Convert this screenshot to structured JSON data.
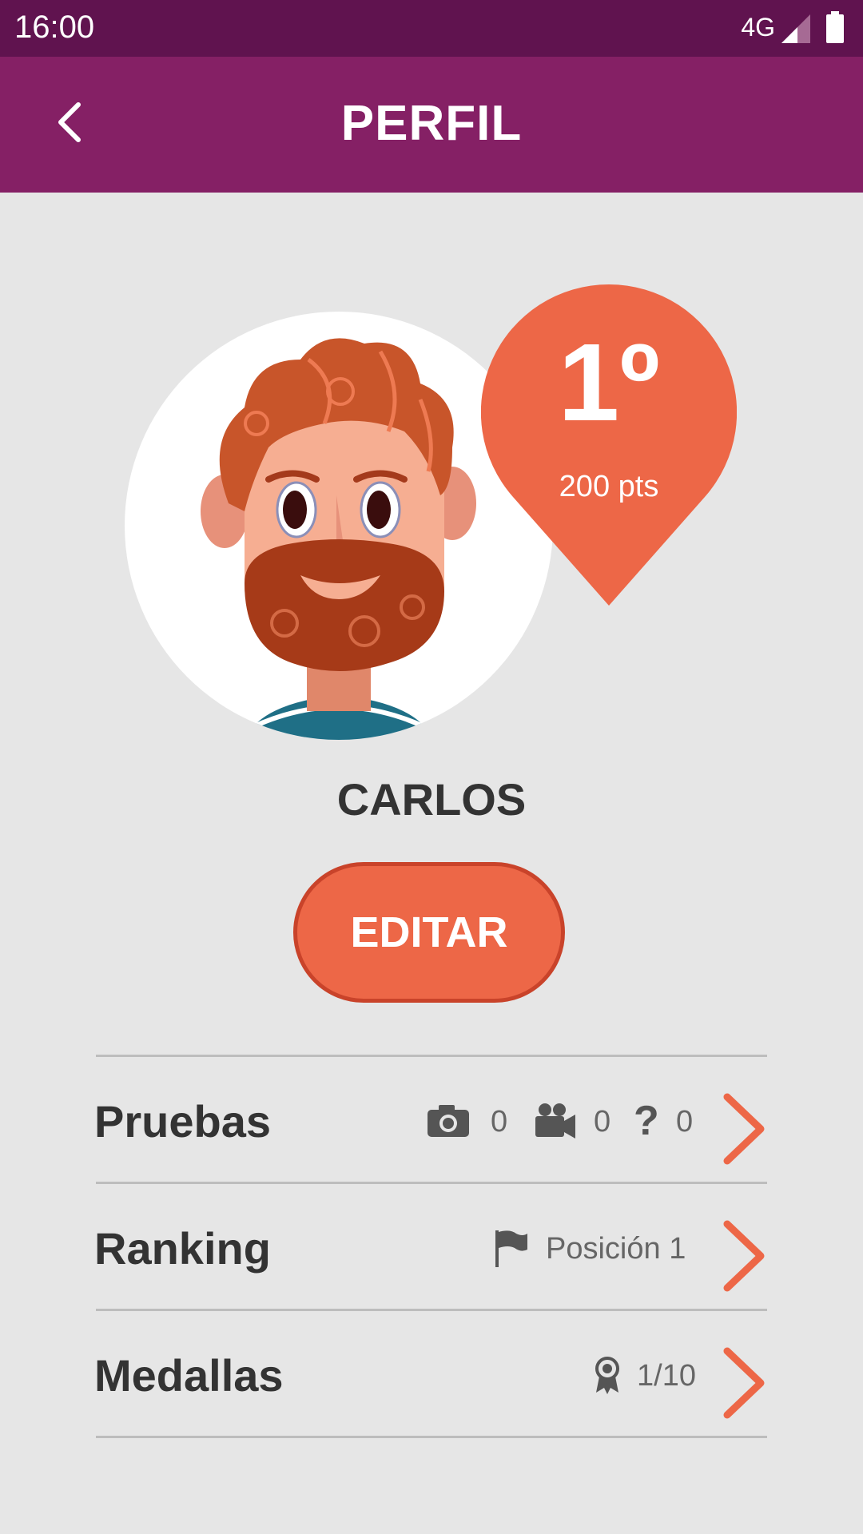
{
  "status_bar": {
    "time": "16:00",
    "network": "4G"
  },
  "app_bar": {
    "title": "PERFIL"
  },
  "profile": {
    "name": "CARLOS",
    "rank": "1º",
    "points": "200 pts",
    "edit_label": "EDITAR"
  },
  "sections": [
    {
      "label": "Pruebas",
      "photos": "0",
      "videos": "0",
      "questions": "0"
    },
    {
      "label": "Ranking",
      "position": "Posición 1"
    },
    {
      "label": "Medallas",
      "medals": "1/10"
    }
  ],
  "colors": {
    "status_bar": "#60134f",
    "app_bar": "#852065",
    "accent": "#ed6747",
    "background": "#e6e6e6"
  },
  "icons": [
    "back-arrow-icon",
    "camera-icon",
    "video-camera-icon",
    "question-icon",
    "flag-icon",
    "medal-icon",
    "chevron-right-icon"
  ]
}
